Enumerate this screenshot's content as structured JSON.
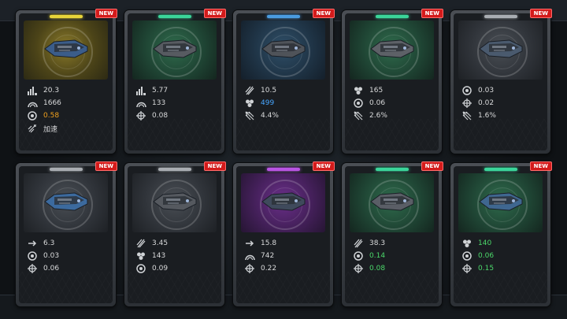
{
  "new_label": "NEW",
  "cards": [
    {
      "theme": "gold",
      "bar": "#e8d53a",
      "ship_color": "#3b5d8a",
      "stats": [
        {
          "icon": "power-bars-icon",
          "value": "20.3",
          "color": "white"
        },
        {
          "icon": "armor-dome-icon",
          "value": "1666",
          "color": "white"
        },
        {
          "icon": "gear-icon",
          "value": "0.58",
          "color": "orange"
        },
        {
          "icon": "boost-icon",
          "value": "加速",
          "color": "white"
        }
      ]
    },
    {
      "theme": "green",
      "bar": "#3bd59a",
      "ship_color": "#575b61",
      "stats": [
        {
          "icon": "power-bars-icon",
          "value": "5.77",
          "color": "white"
        },
        {
          "icon": "armor-dome-icon",
          "value": "133",
          "color": "white"
        },
        {
          "icon": "crosshair-icon",
          "value": "0.08",
          "color": "white"
        }
      ]
    },
    {
      "theme": "blue",
      "bar": "#4a9be0",
      "ship_color": "#4f5359",
      "stats": [
        {
          "icon": "lightning-icon",
          "value": "10.5",
          "color": "white"
        },
        {
          "icon": "cluster-icon",
          "value": "499",
          "color": "blue"
        },
        {
          "icon": "spread-icon",
          "value": "4.4%",
          "color": "white"
        }
      ]
    },
    {
      "theme": "green",
      "bar": "#3bd59a",
      "ship_color": "#5d6167",
      "stats": [
        {
          "icon": "cluster-icon",
          "value": "165",
          "color": "white"
        },
        {
          "icon": "gear-icon",
          "value": "0.06",
          "color": "white"
        },
        {
          "icon": "spread-icon",
          "value": "2.6%",
          "color": "white"
        }
      ]
    },
    {
      "theme": "gray",
      "bar": "#a9adb2",
      "ship_color": "#4a5a6e",
      "stats": [
        {
          "icon": "gear-icon",
          "value": "0.03",
          "color": "white"
        },
        {
          "icon": "crosshair-icon",
          "value": "0.02",
          "color": "white"
        },
        {
          "icon": "spread-icon",
          "value": "1.6%",
          "color": "white"
        }
      ]
    },
    {
      "theme": "gray",
      "bar": "#a9adb2",
      "ship_color": "#3c6a9e",
      "stats": [
        {
          "icon": "arrow-icon",
          "value": "6.3",
          "color": "white"
        },
        {
          "icon": "gear-icon",
          "value": "0.03",
          "color": "white"
        },
        {
          "icon": "crosshair-icon",
          "value": "0.06",
          "color": "white"
        }
      ]
    },
    {
      "theme": "gray",
      "bar": "#a9adb2",
      "ship_color": "#55595f",
      "stats": [
        {
          "icon": "lightning-icon",
          "value": "3.45",
          "color": "white"
        },
        {
          "icon": "cluster-icon",
          "value": "143",
          "color": "white"
        },
        {
          "icon": "gear-icon",
          "value": "0.09",
          "color": "white"
        }
      ]
    },
    {
      "theme": "purple",
      "bar": "#b955e3",
      "ship_color": "#3f4a5c",
      "stats": [
        {
          "icon": "arrow-icon",
          "value": "15.8",
          "color": "white"
        },
        {
          "icon": "armor-dome-icon",
          "value": "742",
          "color": "white"
        },
        {
          "icon": "crosshair-icon",
          "value": "0.22",
          "color": "white"
        }
      ]
    },
    {
      "theme": "green",
      "bar": "#3bd59a",
      "ship_color": "#5a5e66",
      "stats": [
        {
          "icon": "lightning-icon",
          "value": "38.3",
          "color": "white"
        },
        {
          "icon": "gear-icon",
          "value": "0.14",
          "color": "green"
        },
        {
          "icon": "crosshair-icon",
          "value": "0.08",
          "color": "green"
        }
      ]
    },
    {
      "theme": "green",
      "bar": "#3bd59a",
      "ship_color": "#3f6790",
      "stats": [
        {
          "icon": "cluster-icon",
          "value": "140",
          "color": "green"
        },
        {
          "icon": "gear-icon",
          "value": "0.06",
          "color": "green"
        },
        {
          "icon": "crosshair-icon",
          "value": "0.15",
          "color": "green"
        }
      ]
    }
  ]
}
